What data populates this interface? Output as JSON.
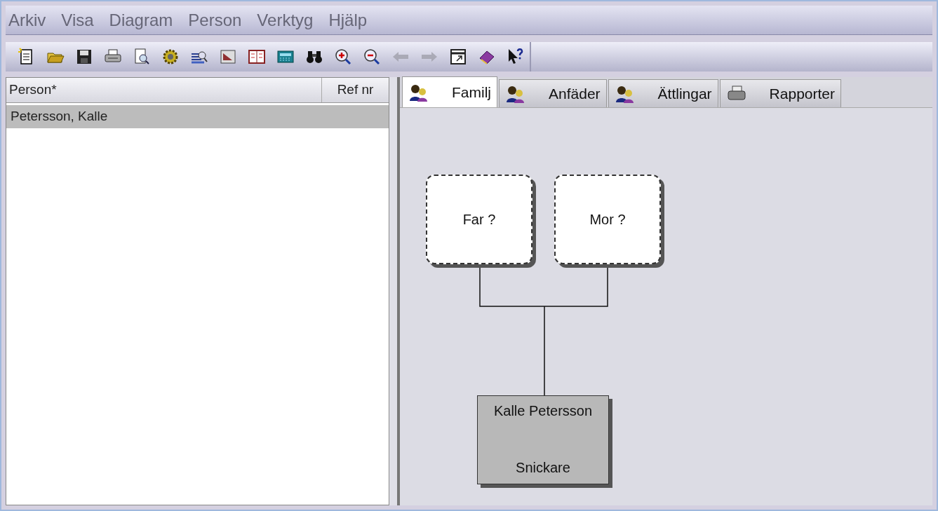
{
  "menu": [
    "Arkiv",
    "Visa",
    "Diagram",
    "Person",
    "Verktyg",
    "Hjälp"
  ],
  "toolbar": [
    {
      "kind": "new",
      "disabled": false
    },
    {
      "kind": "open",
      "disabled": false
    },
    {
      "kind": "save",
      "disabled": false
    },
    {
      "kind": "print",
      "disabled": false
    },
    {
      "kind": "preview",
      "disabled": false
    },
    {
      "kind": "gear",
      "disabled": false
    },
    {
      "kind": "list-search",
      "disabled": false
    },
    {
      "kind": "card",
      "disabled": false
    },
    {
      "kind": "book",
      "disabled": false
    },
    {
      "kind": "calculator",
      "disabled": false
    },
    {
      "kind": "binoculars",
      "disabled": false
    },
    {
      "kind": "zoom-in",
      "disabled": false
    },
    {
      "kind": "zoom-out",
      "disabled": false
    },
    {
      "kind": "back",
      "disabled": true
    },
    {
      "kind": "forward",
      "disabled": true
    },
    {
      "kind": "window",
      "disabled": false
    },
    {
      "kind": "help-book",
      "disabled": false
    },
    {
      "kind": "help-pointer",
      "disabled": false
    }
  ],
  "person_list": {
    "columns": [
      "Person*",
      "Ref nr"
    ],
    "rows": [
      {
        "name": "Petersson, Kalle",
        "selected": true
      }
    ]
  },
  "tabs": [
    {
      "label": "Familj",
      "kind": "people",
      "selected": true
    },
    {
      "label": "Anfäder",
      "kind": "people",
      "selected": false
    },
    {
      "label": "Ättlingar",
      "kind": "people",
      "selected": false
    },
    {
      "label": "Rapporter",
      "kind": "printer",
      "selected": false
    }
  ],
  "diagram": {
    "parents": [
      {
        "label": "Far ?",
        "unknown": true
      },
      {
        "label": "Mor ?",
        "unknown": true
      }
    ],
    "child": {
      "name": "Kalle Petersson",
      "occupation": "Snickare"
    }
  }
}
